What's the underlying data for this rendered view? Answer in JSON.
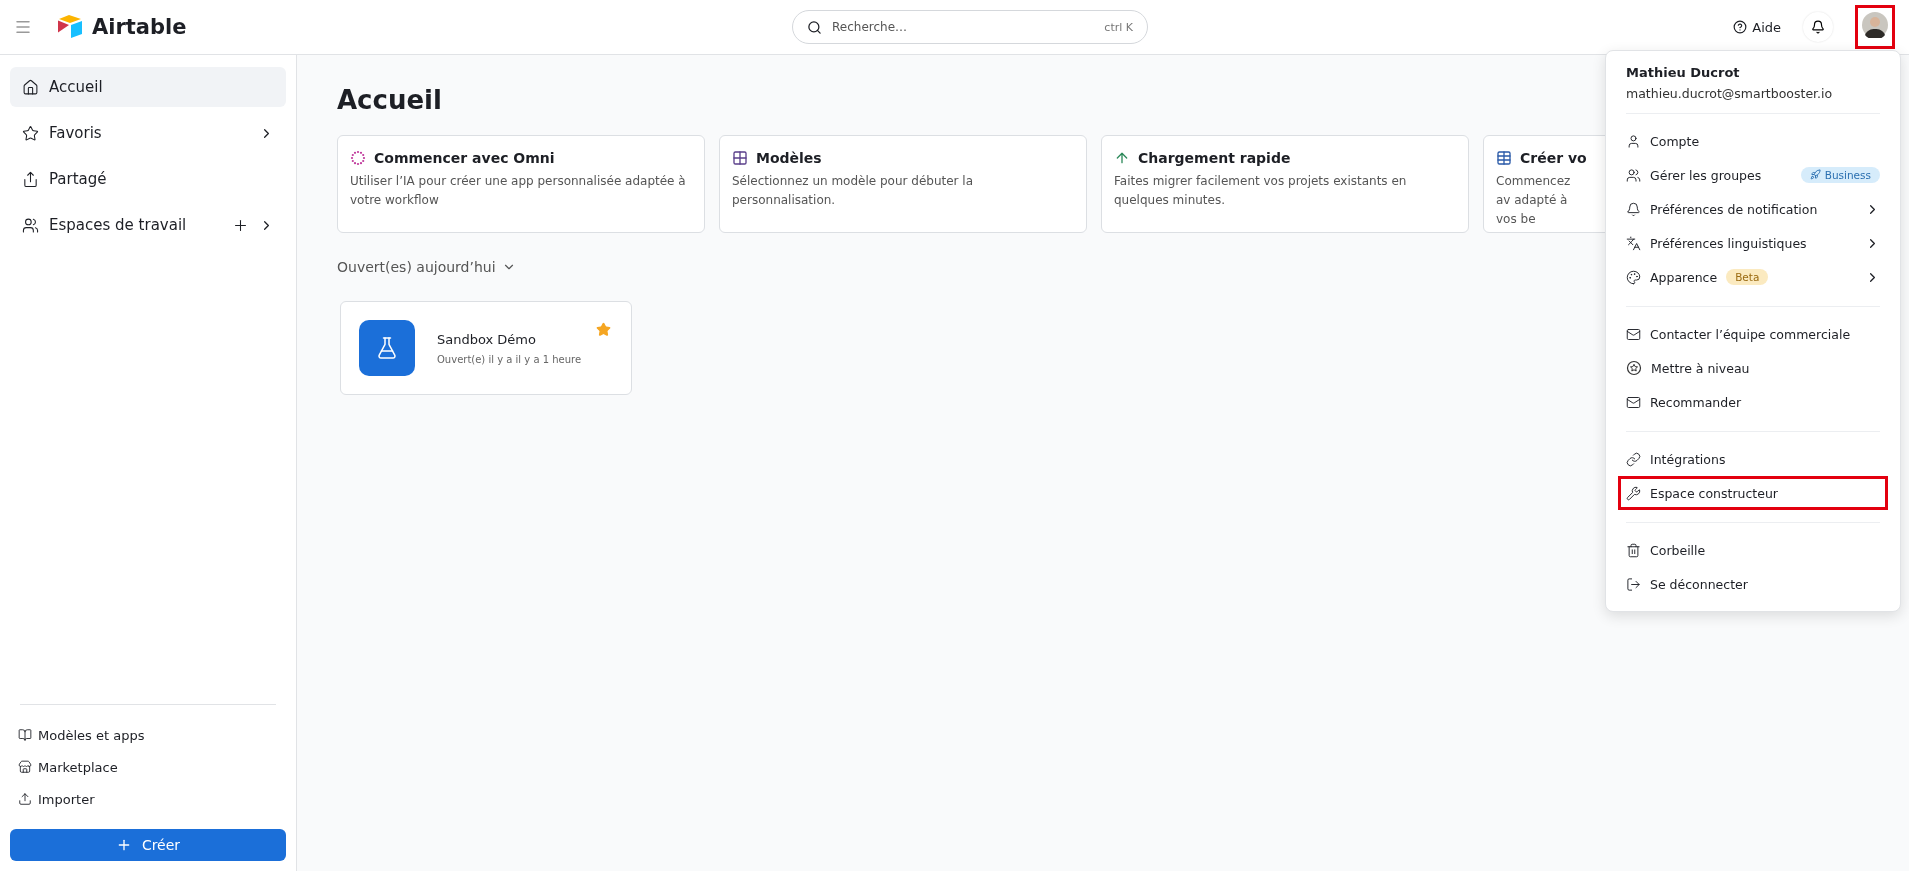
{
  "header": {
    "logo": "Airtable",
    "search": {
      "placeholder": "Recherche…",
      "shortcut": "ctrl K"
    },
    "help": "Aide",
    "avatar_highlighted": true
  },
  "sidebar": {
    "items": [
      {
        "label": "Accueil",
        "selected": true,
        "has_submenu": false,
        "has_add": false
      },
      {
        "label": "Favoris",
        "selected": false,
        "has_submenu": true,
        "has_add": false
      },
      {
        "label": "Partagé",
        "selected": false,
        "has_submenu": false,
        "has_add": false
      },
      {
        "label": "Espaces de travail",
        "selected": false,
        "has_submenu": true,
        "has_add": true
      }
    ],
    "footer_items": [
      "Modèles et apps",
      "Marketplace",
      "Importer"
    ],
    "create_button": "Créer"
  },
  "main": {
    "title": "Accueil",
    "cards": [
      {
        "title": "Commencer avec Omni",
        "text": "Utiliser l’IA pour créer une app personnalisée adaptée à votre workflow"
      },
      {
        "title": "Modèles",
        "text": "Sélectionnez un modèle pour débuter la personnalisation."
      },
      {
        "title": "Chargement rapide",
        "text": "Faites migrer facilement vos projets existants en quelques minutes."
      },
      {
        "title": "Créer vo",
        "text": "Commencez av adapté à vos be"
      }
    ],
    "section": "Ouvert(es) aujourd’hui",
    "bases": [
      {
        "name": "Sandbox Démo",
        "opened": "Ouvert(e) il y a il y a 1 heure",
        "favorite": true
      }
    ]
  },
  "account_menu": {
    "name": "Mathieu Ducrot",
    "email": "mathieu.ducrot@smartbooster.io",
    "sections": [
      [
        {
          "label": "Compte",
          "has_submenu": false,
          "highlighted": false
        },
        {
          "label": "Gérer les groupes",
          "has_submenu": false,
          "highlighted": false,
          "badge": {
            "text": "Business",
            "kind": "business"
          }
        },
        {
          "label": "Préférences de notification",
          "has_submenu": true,
          "highlighted": false
        },
        {
          "label": "Préférences linguistiques",
          "has_submenu": true,
          "highlighted": false
        },
        {
          "label": "Apparence",
          "has_submenu": true,
          "highlighted": false,
          "badge": {
            "text": "Beta",
            "kind": "beta"
          }
        }
      ],
      [
        {
          "label": "Contacter l’équipe commerciale",
          "has_submenu": false,
          "highlighted": false
        },
        {
          "label": "Mettre à niveau",
          "has_submenu": false,
          "highlighted": false
        },
        {
          "label": "Recommander",
          "has_submenu": false,
          "highlighted": false
        }
      ],
      [
        {
          "label": "Intégrations",
          "has_submenu": false,
          "highlighted": false
        },
        {
          "label": "Espace constructeur",
          "has_submenu": false,
          "highlighted": true
        }
      ],
      [
        {
          "label": "Corbeille",
          "has_submenu": false,
          "highlighted": false
        },
        {
          "label": "Se déconnecter",
          "has_submenu": false,
          "highlighted": false
        }
      ]
    ]
  }
}
